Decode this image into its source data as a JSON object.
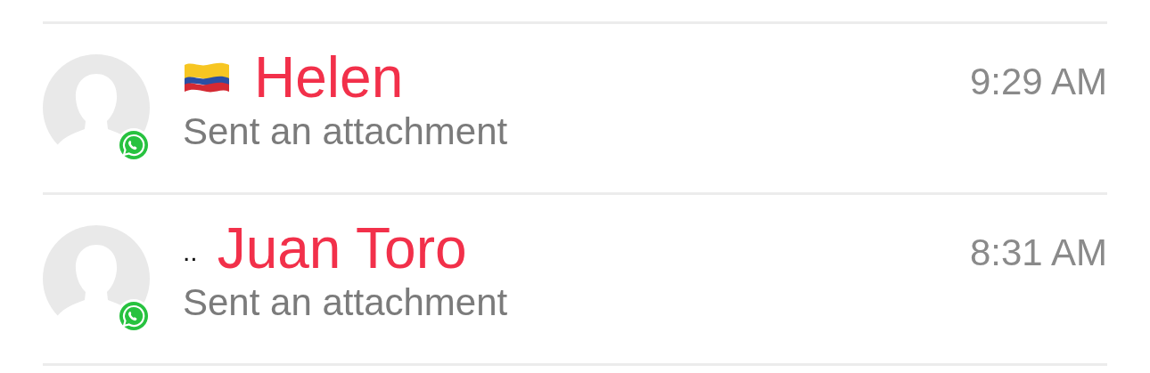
{
  "chats": [
    {
      "prefix": {
        "kind": "flag"
      },
      "name": "Helen",
      "preview": "Sent an attachment",
      "time": "9:29 AM",
      "online_badge": true
    },
    {
      "prefix": {
        "kind": "text",
        "text": ".."
      },
      "name": "Juan Toro",
      "preview": "Sent an attachment",
      "time": "8:31 AM",
      "online_badge": true
    }
  ]
}
